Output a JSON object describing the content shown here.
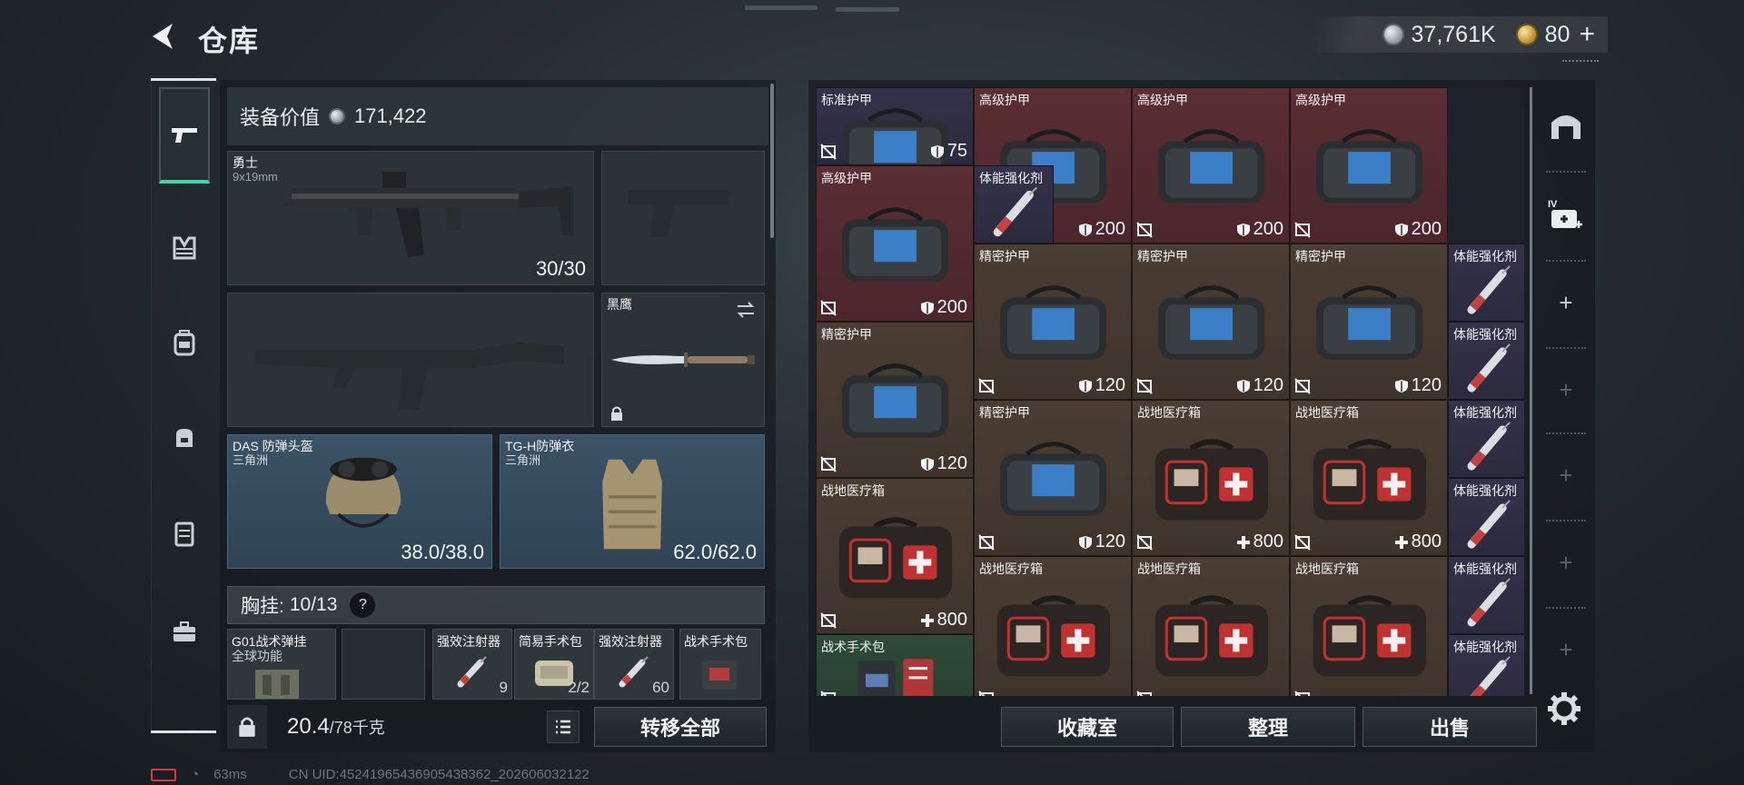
{
  "header": {
    "title": "仓库",
    "silver": "37,761K",
    "gold": "80"
  },
  "loadout": {
    "value_label": "装备价值",
    "value": "171,422",
    "primary": {
      "name": "勇士",
      "caliber": "9x19mm",
      "ammo": "30/30"
    },
    "melee": {
      "name": "黑鹰"
    },
    "helmet": {
      "name": "DAS 防弹头盔",
      "origin": "三角洲",
      "durability": "38.0/38.0"
    },
    "armor": {
      "name": "TG-H防弹衣",
      "origin": "三角洲",
      "durability": "62.0/62.0"
    },
    "chest_rig_label": "胸挂:",
    "chest_rig_capacity": "10/13",
    "help": "?",
    "chest_items": [
      {
        "name": "G01战术弹挂",
        "sub": "全球功能",
        "count": ""
      },
      {
        "name": "",
        "sub": "",
        "count": ""
      },
      {
        "name": "强效注射器",
        "count": "9"
      },
      {
        "name": "简易手术包",
        "count": "2/2"
      },
      {
        "name": "强效注射器",
        "count": "60"
      },
      {
        "name": "战术手术包",
        "count": ""
      }
    ],
    "weight": "20.4",
    "weight_max": "/78千克",
    "transfer_all": "转移全部"
  },
  "storage": {
    "items": [
      {
        "name": "标准护甲",
        "value": "75",
        "kind": "armor"
      },
      {
        "name": "高级护甲",
        "value": "200",
        "kind": "armor"
      },
      {
        "name": "高级护甲",
        "value": "200",
        "kind": "armor"
      },
      {
        "name": "高级护甲",
        "value": "200",
        "kind": "armor"
      },
      {
        "name": "高级护甲",
        "value": "200",
        "kind": "armor"
      },
      {
        "name": "体能强化剂",
        "value": "",
        "kind": "syringe"
      },
      {
        "name": "精密护甲",
        "value": "120",
        "kind": "armor"
      },
      {
        "name": "精密护甲",
        "value": "120",
        "kind": "armor"
      },
      {
        "name": "精密护甲",
        "value": "120",
        "kind": "armor"
      },
      {
        "name": "体能强化剂",
        "value": "",
        "kind": "syringe"
      },
      {
        "name": "精密护甲",
        "value": "120",
        "kind": "armor"
      },
      {
        "name": "体能强化剂",
        "value": "",
        "kind": "syringe"
      },
      {
        "name": "精密护甲",
        "value": "120",
        "kind": "armor"
      },
      {
        "name": "战地医疗箱",
        "value": "800",
        "kind": "medkit"
      },
      {
        "name": "战地医疗箱",
        "value": "800",
        "kind": "medkit"
      },
      {
        "name": "体能强化剂",
        "value": "",
        "kind": "syringe"
      },
      {
        "name": "战地医疗箱",
        "value": "800",
        "kind": "medkit"
      },
      {
        "name": "体能强化剂",
        "value": "",
        "kind": "syringe"
      },
      {
        "name": "精密护甲",
        "value": "120",
        "kind": "armor"
      },
      {
        "name": "战地医疗箱",
        "value": "",
        "kind": "medkit"
      },
      {
        "name": "战地医疗箱",
        "value": "",
        "kind": "medkit"
      },
      {
        "name": "战地医疗箱",
        "value": "",
        "kind": "medkit"
      },
      {
        "name": "体能强化剂",
        "value": "",
        "kind": "syringe"
      },
      {
        "name": "战术手术包",
        "value": "",
        "kind": "surgery"
      },
      {
        "name": "体能强化剂",
        "value": "",
        "kind": "syringe"
      }
    ],
    "buttons": {
      "collection": "收藏室",
      "sort": "整理",
      "sell": "出售"
    }
  },
  "right_rail": {
    "plus": "+",
    "iv_label": "IV"
  },
  "footer": {
    "ping": "63ms",
    "uid": "CN UID:4524196543690543836​2_202606032122"
  },
  "colors": {
    "accent": "#3fd7a1",
    "red_cell": "#5a2e33",
    "brown_cell": "#4a3d33",
    "violet_cell": "#34324a"
  }
}
